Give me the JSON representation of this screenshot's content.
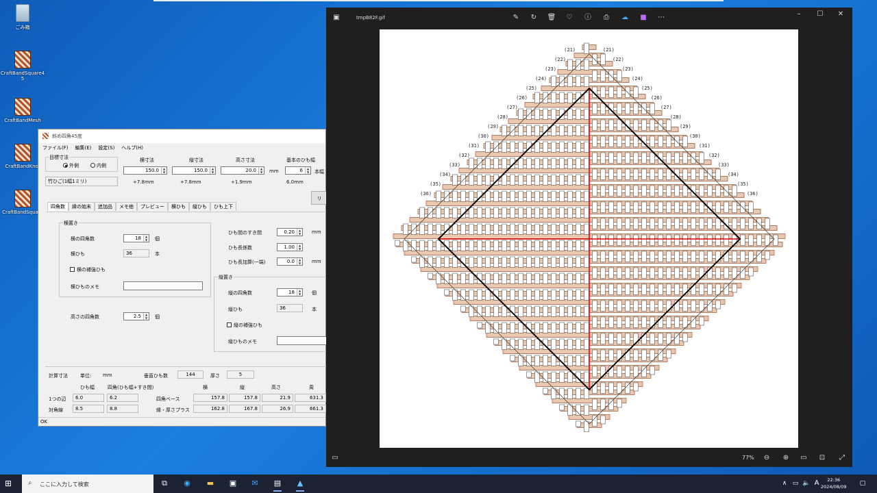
{
  "desktop": {
    "icons": [
      {
        "label": "ごみ箱",
        "kind": "recycle"
      },
      {
        "label": "CraftBandSquare45",
        "kind": "band"
      },
      {
        "label": "CraftBandMesh",
        "kind": "band"
      },
      {
        "label": "CraftBandKnot",
        "kind": "band"
      },
      {
        "label": "CraftBandSquare",
        "kind": "band"
      }
    ]
  },
  "app": {
    "title": "斜め四角45度",
    "menu": [
      "ファイル(F)",
      "編集(E)",
      "設定(S)",
      "ヘルプ(H)"
    ],
    "target": {
      "group_label": "目標寸法",
      "radio_outer": "外側",
      "radio_inner": "内側",
      "material": "竹ひご(1幅1ミリ)",
      "col_width": "横寸法",
      "col_depth": "縦寸法",
      "col_height": "高さ寸法",
      "col_band": "基本のひも幅",
      "width_value": "150.0",
      "depth_value": "150.0",
      "height_value": "20.0",
      "unit_mm": "mm",
      "band_value": "6",
      "band_unit": "本幅",
      "width_diff": "+7.8mm",
      "depth_diff": "+7.8mm",
      "height_diff": "+1.9mm",
      "band_mm": "6.0mm",
      "right_button": "リ"
    },
    "tabs": [
      "四角数",
      "縁の始末",
      "追加品",
      "メモ他",
      "プレビュー",
      "横ひも",
      "縦ひも",
      "ひも上下"
    ],
    "horizontal": {
      "group_label": "横置き",
      "count_label": "横の四角数",
      "count_value": "18",
      "count_unit": "個",
      "bands_label": "横ひも",
      "bands_value": "36",
      "bands_unit": "本",
      "reinforce_label": "横の補強ひも",
      "memo_label": "横ひものメモ"
    },
    "height": {
      "label": "高さの四角数",
      "value": "2.5",
      "unit": "個"
    },
    "gaps": {
      "gap_label": "ひも間のすき間",
      "gap_value": "0.20",
      "gap_unit": "mm",
      "len_label": "ひも長係数",
      "len_value": "1.00",
      "add_label": "ひも長加算(一端)",
      "add_value": "0.0",
      "add_unit": "mm"
    },
    "vertical": {
      "group_label": "縦置き",
      "count_label": "縦の四角数",
      "count_value": "18",
      "count_unit": "個",
      "bands_label": "縦ひも",
      "bands_value": "36",
      "bands_unit": "本",
      "reinforce_label": "縦の補強ひも",
      "memo_label": "縦ひものメモ"
    },
    "calc": {
      "label": "計算寸法",
      "unit_label": "単位:",
      "unit_value": "mm",
      "vbands_label": "垂直ひも数",
      "vbands_value": "144",
      "thick_label": "厚さ",
      "thick_value": "5",
      "h_band": "ひも幅",
      "h_square": "四角(ひも幅+すき間)",
      "h_w": "横",
      "h_d": "縦",
      "h_h": "高さ",
      "h_p": "周",
      "r1_label": "1つの辺",
      "r1_band": "6.0",
      "r1_square": "6.2",
      "r2_label": "対角線",
      "r2_band": "8.5",
      "r2_square": "8.8",
      "base_label": "四角ベース",
      "base_w": "157.8",
      "base_d": "157.8",
      "base_h": "21.9",
      "base_p": "631.3",
      "edge_label": "縁・厚さプラス",
      "edge_w": "162.8",
      "edge_d": "167.8",
      "edge_h": "26.9",
      "edge_p": "661.3"
    },
    "status": "OK"
  },
  "viewer": {
    "filename": "tmpB82F.gif",
    "zoom": "77%",
    "labels_top_left": [
      "(21)",
      "(22)",
      "(23)",
      "(24)",
      "(25)",
      "(26)",
      "(27)",
      "(28)",
      "(29)",
      "(30)",
      "(31)",
      "(32)",
      "(33)",
      "(34)",
      "(35)",
      "(36)"
    ],
    "labels_top_right": [
      "(21)",
      "(22)",
      "(23)",
      "(24)",
      "(25)",
      "(26)",
      "(27)",
      "(28)",
      "(29)",
      "(30)",
      "(31)",
      "(32)",
      "(33)",
      "(34)",
      "(35)",
      "(36)"
    ],
    "colors": {
      "band_fill": "#e8c8b0",
      "band_line": "#8a3a14",
      "red_axis": "#e00000",
      "frame": "#000000"
    }
  },
  "taskbar": {
    "search_placeholder": "ここに入力して検索",
    "ime": "A",
    "time": "22:36",
    "date": "2024/08/09"
  }
}
